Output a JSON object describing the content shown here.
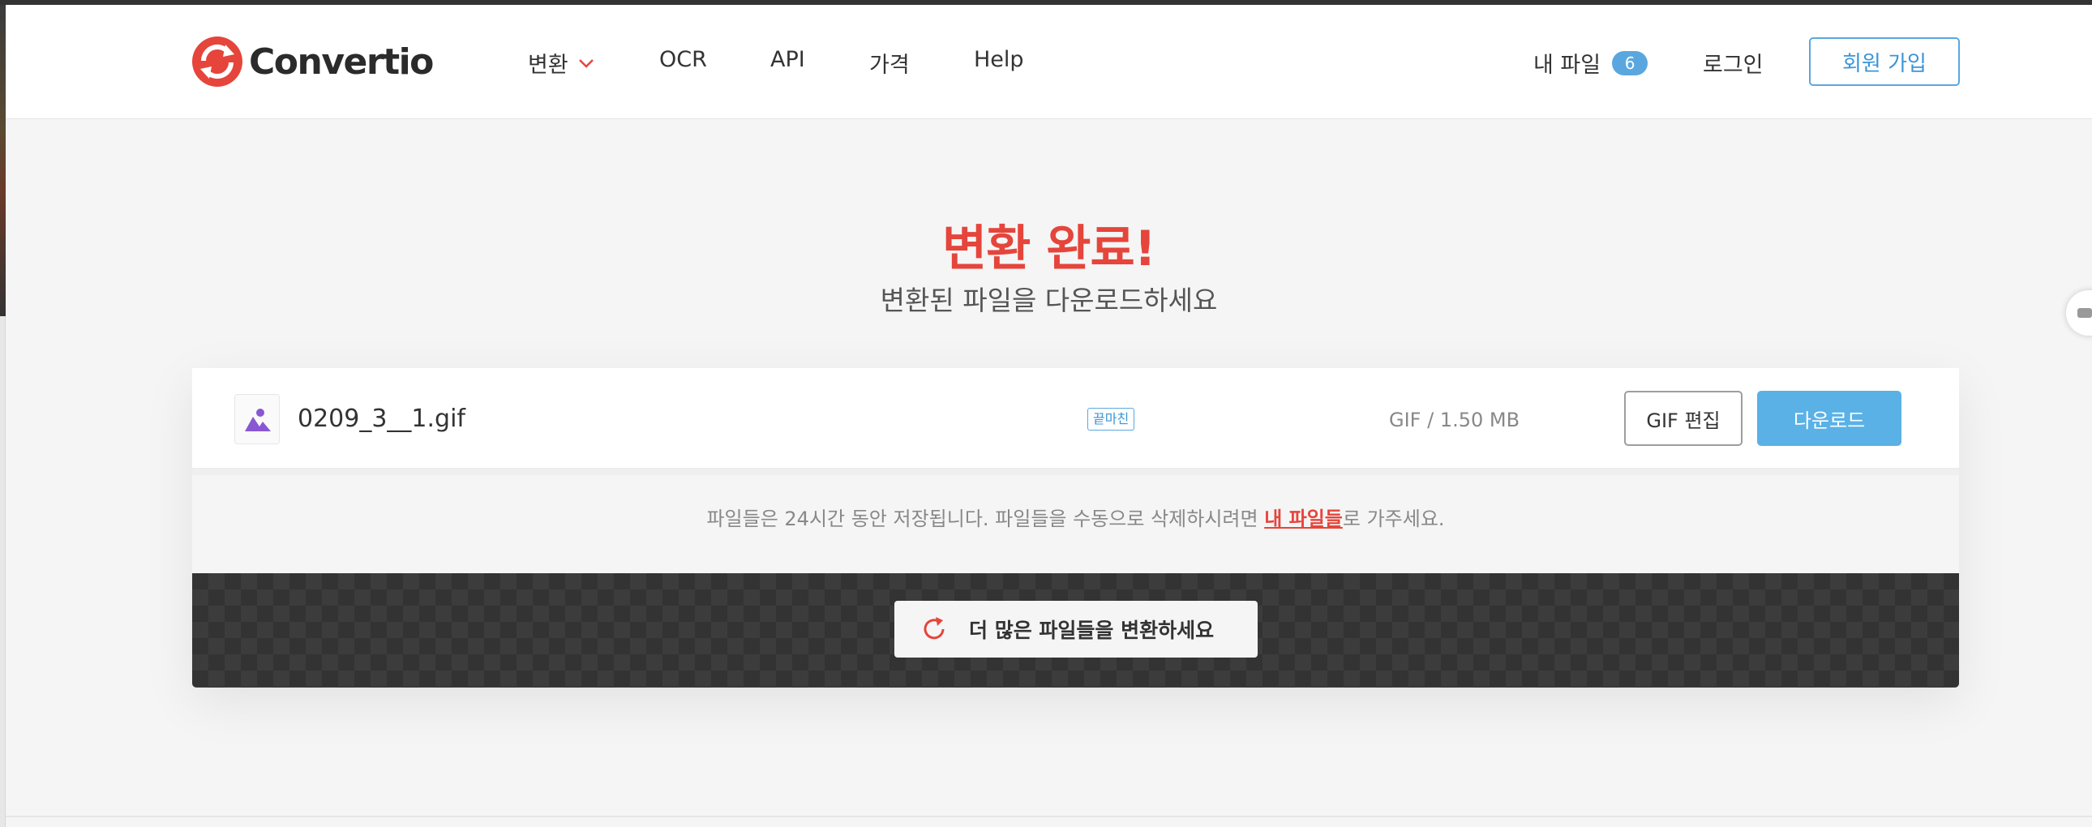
{
  "brand": {
    "name": "Convertio"
  },
  "nav": {
    "convert": "변환",
    "ocr": "OCR",
    "api": "API",
    "price": "가격",
    "help": "Help",
    "my_files": "내 파일",
    "my_files_count": "6",
    "login": "로그인",
    "signup": "회원 가입"
  },
  "main": {
    "title": "변환 완료!",
    "subtitle": "변환된 파일을 다운로드하세요"
  },
  "file": {
    "name": "0209_3__1.gif",
    "badge": "끝마친",
    "meta": "GIF / 1.50 MB",
    "edit_label": "GIF 편집",
    "download_label": "다운로드"
  },
  "info": {
    "text_before": "파일들은 24시간 동안 저장됩니다. 파일들을 수동으로 삭제하시려면 ",
    "link": "내 파일들",
    "text_after": "로 가주세요."
  },
  "more": {
    "label": "더 많은 파일들을 변환하세요"
  },
  "colors": {
    "accent_red": "#e5453b",
    "accent_blue": "#5aa7e0",
    "download_blue": "#5ab1e6",
    "dark_band": "#333333"
  },
  "icons": {
    "logo": "convertio-logo-icon",
    "convert_dropdown": "chevron-down-icon",
    "file_type": "image-file-icon",
    "refresh": "refresh-icon"
  }
}
